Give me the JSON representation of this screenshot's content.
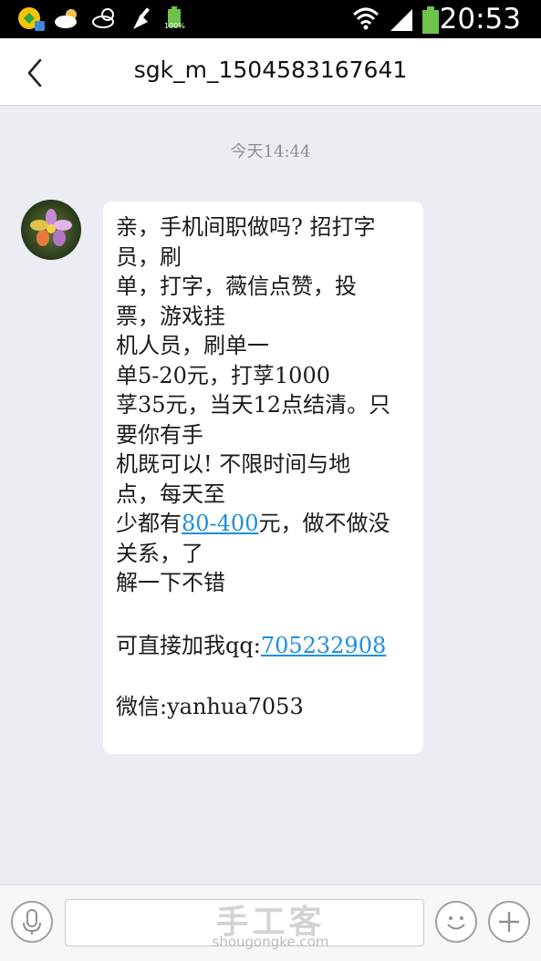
{
  "status_bar": {
    "time": "20:53",
    "battery_label": "100%",
    "icons": [
      "app-notification-icon",
      "weather-cloud-icon",
      "weather-partly-cloudy-icon",
      "cleaner-icon",
      "battery-small-icon",
      "wifi-icon",
      "signal-icon",
      "battery-icon"
    ]
  },
  "header": {
    "title": "sgk_m_1504583167641",
    "back_icon": "chevron-left-icon"
  },
  "conversation": {
    "timestamp": "今天14:44",
    "message": {
      "avatar": "flower-avatar",
      "lines": [
        "亲，手机间职做吗? 招打字",
        "员，刷",
        "单，打字，薇信点赞，投",
        "票，游戏挂",
        "机人员，刷单一",
        "单5-20元，打莩1000",
        "莩35元，当天12点结清。只",
        "要你有手",
        "机既可以! 不限时间与地",
        "点，每天至"
      ],
      "line_link_prefix": "少都有",
      "line_link_text": "80-400",
      "line_link_suffix": "元，做不做没",
      "lines_after": [
        "关系，了",
        "解一下不错"
      ],
      "qq_prefix": "可直接加我qq:",
      "qq_number": "705232908",
      "wechat": "微信:yanhua7053"
    }
  },
  "input_bar": {
    "voice_icon": "microphone-icon",
    "emoji_icon": "smiley-icon",
    "plus_icon": "plus-icon",
    "input_value": ""
  },
  "watermark": {
    "main": "手工客",
    "sub": "shougongke.com"
  },
  "colors": {
    "background": "#ebedf2",
    "link": "#1e8fe0",
    "status_bar": "#000000",
    "battery_green": "#6cc24a"
  }
}
